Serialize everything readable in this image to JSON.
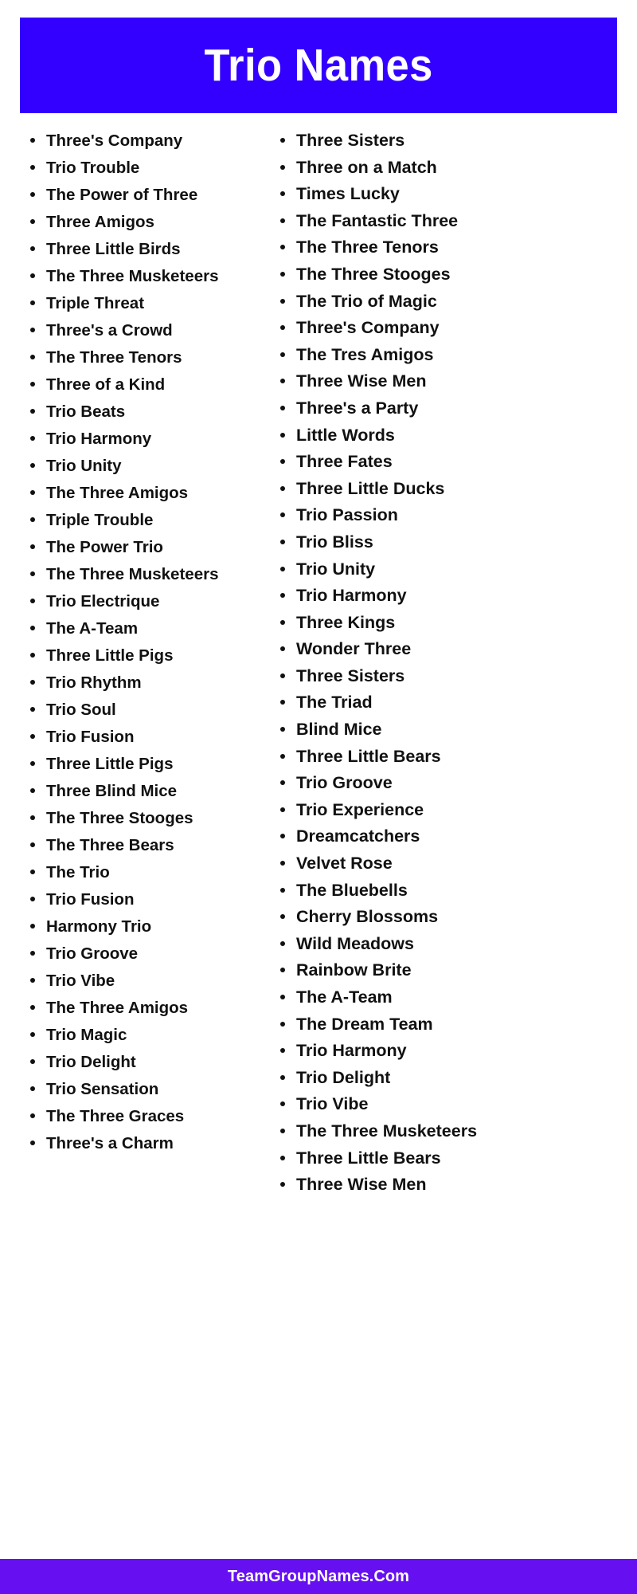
{
  "header": {
    "title": "Trio Names",
    "background_color": "#3300FF",
    "text_color": "#FFFFFF"
  },
  "footer": {
    "text": "TeamGroupNames.Com",
    "background_color": "#6610F2",
    "text_color": "#FFFFFF"
  },
  "columns": {
    "left": [
      "Three's Company",
      "Trio Trouble",
      "The Power of Three",
      "Three Amigos",
      "Three Little Birds",
      "The Three Musketeers",
      "Triple Threat",
      "Three's a Crowd",
      "The Three Tenors",
      "Three of a Kind",
      "Trio Beats",
      "Trio Harmony",
      "Trio Unity",
      "The Three Amigos",
      "Triple Trouble",
      "The Power Trio",
      "The Three Musketeers",
      "Trio Electrique",
      "The A-Team",
      "Three Little Pigs",
      "Trio Rhythm",
      "Trio Soul",
      "Trio Fusion",
      "Three Little Pigs",
      "Three Blind Mice",
      "The Three Stooges",
      "The Three Bears",
      "The Trio",
      "Trio Fusion",
      "Harmony Trio",
      "Trio Groove",
      "Trio Vibe",
      "The Three Amigos",
      "Trio Magic",
      "Trio Delight",
      "Trio Sensation",
      "The Three Graces",
      "Three's a Charm"
    ],
    "right": [
      "Three Sisters",
      "Three on a Match",
      "Times Lucky",
      "The Fantastic Three",
      "The Three Tenors",
      "The Three Stooges",
      "The Trio of Magic",
      "Three's Company",
      "The Tres Amigos",
      "Three Wise Men",
      "Three's a Party",
      "Little Words",
      "Three Fates",
      "Three Little Ducks",
      "Trio Passion",
      "Trio Bliss",
      "Trio Unity",
      "Trio Harmony",
      "Three Kings",
      "Wonder Three",
      "Three Sisters",
      "The Triad",
      "Blind Mice",
      "Three Little Bears",
      "Trio Groove",
      "Trio Experience",
      "Dreamcatchers",
      "Velvet Rose",
      "The Bluebells",
      "Cherry Blossoms",
      "Wild Meadows",
      "Rainbow Brite",
      "The A-Team",
      "The Dream Team",
      "Trio Harmony",
      "Trio Delight",
      "Trio Vibe",
      "The Three Musketeers",
      "Three Little Bears",
      "Three Wise Men"
    ]
  }
}
